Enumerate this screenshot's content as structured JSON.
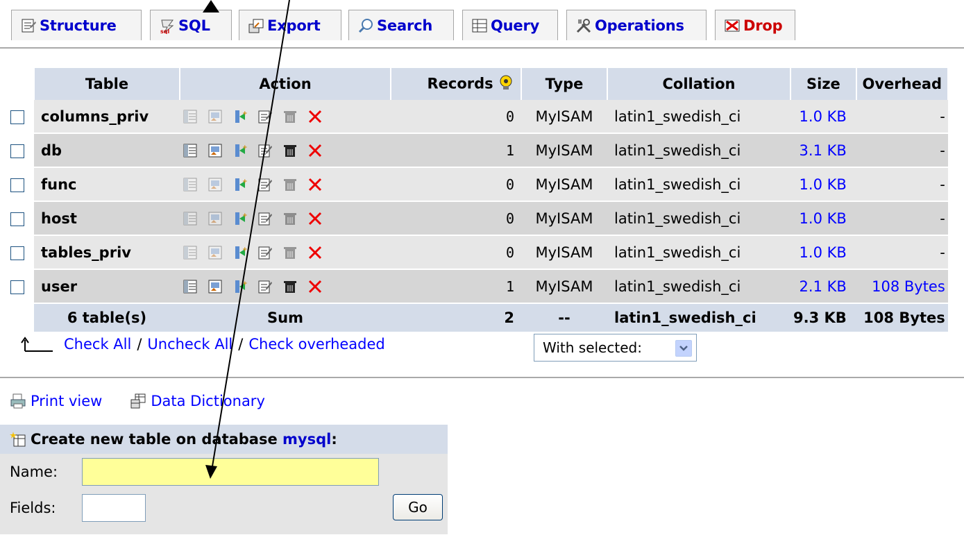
{
  "tabs": [
    {
      "label": "Structure",
      "icon": "structure-icon"
    },
    {
      "label": "SQL",
      "icon": "sql-icon"
    },
    {
      "label": "Export",
      "icon": "export-icon"
    },
    {
      "label": "Search",
      "icon": "search-icon"
    },
    {
      "label": "Query",
      "icon": "query-icon"
    },
    {
      "label": "Operations",
      "icon": "operations-icon"
    },
    {
      "label": "Drop",
      "icon": "drop-icon"
    }
  ],
  "table": {
    "headers": {
      "table": "Table",
      "action": "Action",
      "records": "Records",
      "type": "Type",
      "collation": "Collation",
      "size": "Size",
      "overhead": "Overhead"
    },
    "rows": [
      {
        "name": "columns_priv",
        "records": "0",
        "type": "MyISAM",
        "collation": "latin1_swedish_ci",
        "size": "1.0 KB",
        "overhead": "-",
        "empty": true
      },
      {
        "name": "db",
        "records": "1",
        "type": "MyISAM",
        "collation": "latin1_swedish_ci",
        "size": "3.1 KB",
        "overhead": "-",
        "empty": false
      },
      {
        "name": "func",
        "records": "0",
        "type": "MyISAM",
        "collation": "latin1_swedish_ci",
        "size": "1.0 KB",
        "overhead": "-",
        "empty": true
      },
      {
        "name": "host",
        "records": "0",
        "type": "MyISAM",
        "collation": "latin1_swedish_ci",
        "size": "1.0 KB",
        "overhead": "-",
        "empty": true
      },
      {
        "name": "tables_priv",
        "records": "0",
        "type": "MyISAM",
        "collation": "latin1_swedish_ci",
        "size": "1.0 KB",
        "overhead": "-",
        "empty": true
      },
      {
        "name": "user",
        "records": "1",
        "type": "MyISAM",
        "collation": "latin1_swedish_ci",
        "size": "2.1 KB",
        "overhead": "108 Bytes",
        "empty": false
      }
    ],
    "sum": {
      "tables": "6 table(s)",
      "label": "Sum",
      "records": "2",
      "type": "--",
      "collation": "latin1_swedish_ci",
      "size": "9.3 KB",
      "overhead": "108 Bytes"
    }
  },
  "selection": {
    "check_all": "Check All",
    "uncheck_all": "Uncheck All",
    "check_overheaded": "Check overheaded",
    "separator": "/",
    "with_selected": "With selected:"
  },
  "links": {
    "print_view": "Print view",
    "data_dictionary": "Data Dictionary"
  },
  "create_table": {
    "heading": "Create new table on database",
    "database": "mysql",
    "colon": ":",
    "name_label": "Name:",
    "name_value": "",
    "fields_label": "Fields:",
    "fields_value": "",
    "go_label": "Go"
  },
  "colors": {
    "link": "#0000ff",
    "header_bg": "#d4dce9",
    "row_light": "#e7e7e7",
    "row_dark": "#d6d6d6",
    "name_input_bg": "#ffff99",
    "drop_red": "#cc0000"
  }
}
